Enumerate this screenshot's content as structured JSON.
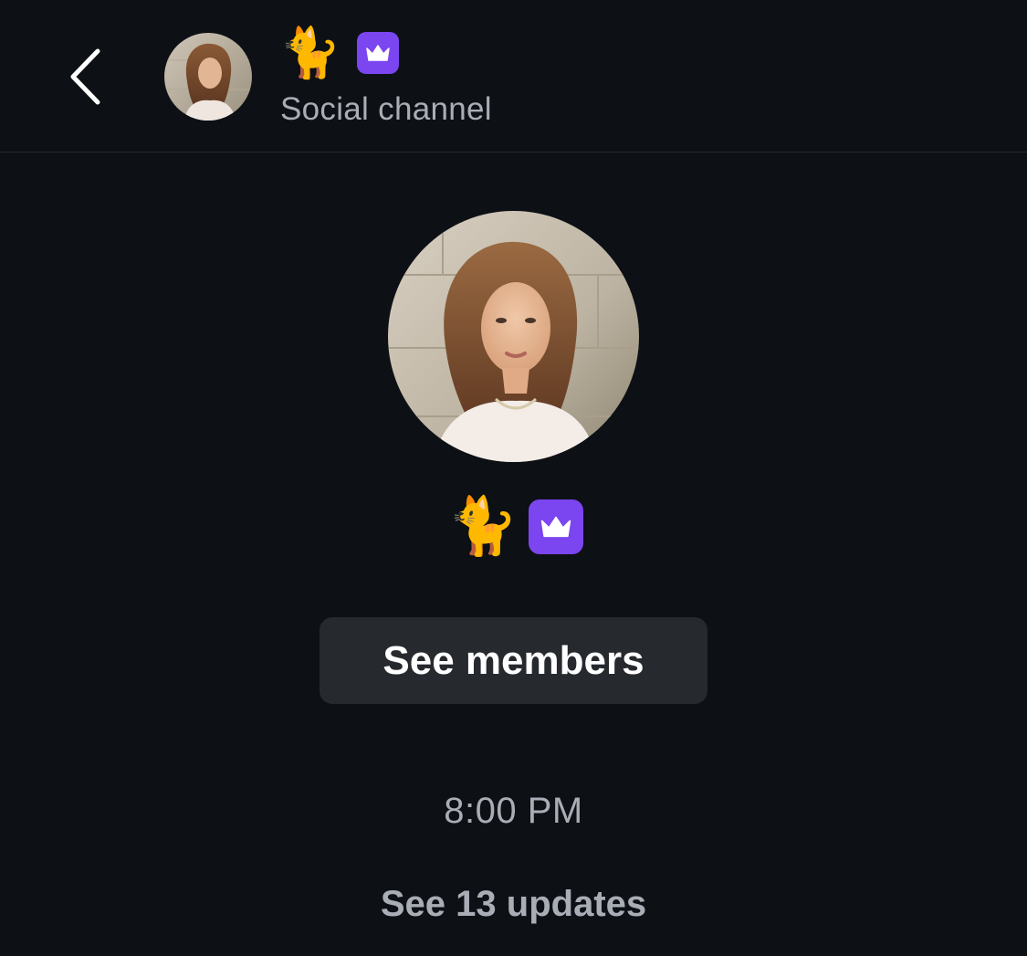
{
  "header": {
    "back_icon": "chevron-left-icon",
    "avatar_alt": "profile-photo",
    "name_emoji": "🐈",
    "badge_icon": "crown-icon",
    "subtitle": "Social channel"
  },
  "profile": {
    "name_emoji": "🐈",
    "badge_icon": "crown-icon"
  },
  "actions": {
    "see_members_label": "See members"
  },
  "feed": {
    "timestamp": "8:00 PM",
    "updates_label": "See 13 updates"
  },
  "colors": {
    "background": "#0d1015",
    "badge": "#7b45ef",
    "button": "#26292e",
    "muted_text": "#a9adb5"
  }
}
